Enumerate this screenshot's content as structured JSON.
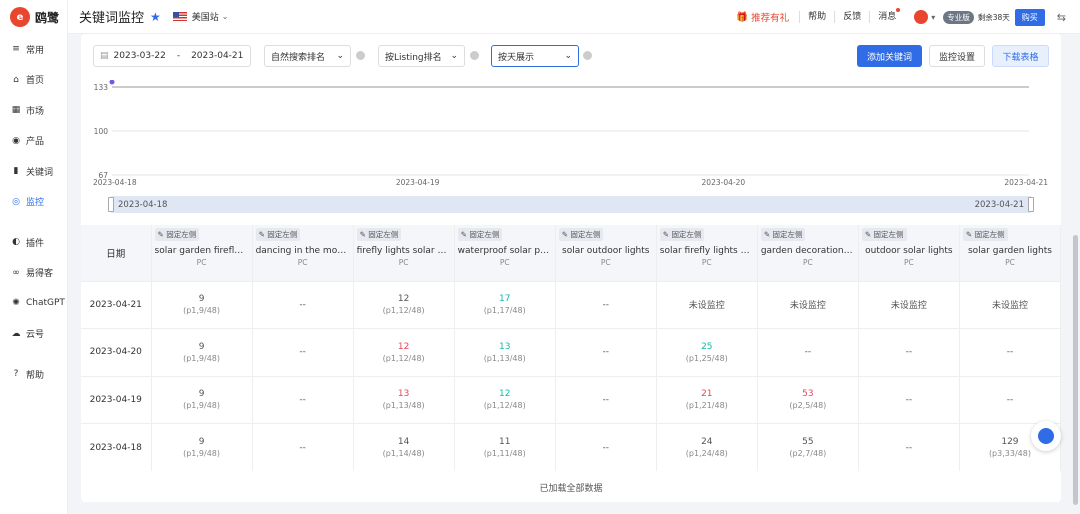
{
  "app": {
    "logo_letter": "e",
    "logo_text": "鸥鹭"
  },
  "sidebar": {
    "items": [
      {
        "label": "常用",
        "icon": "≡"
      },
      {
        "label": "首页",
        "icon": "⌂"
      },
      {
        "label": "市场",
        "icon": "▦"
      },
      {
        "label": "产品",
        "icon": "◉"
      },
      {
        "label": "关键词",
        "icon": "▮"
      },
      {
        "label": "监控",
        "icon": "◎"
      },
      {
        "label": "插件",
        "icon": "◐"
      },
      {
        "label": "易得客",
        "icon": "∞"
      },
      {
        "label": "ChatGPT",
        "icon": "✺"
      },
      {
        "label": "云号",
        "icon": "☁"
      },
      {
        "label": "帮助",
        "icon": "?"
      }
    ]
  },
  "topbar": {
    "title": "关键词监控",
    "site": "美国站",
    "promo": "推荐有礼",
    "help": "帮助",
    "feedback": "反馈",
    "message": "消息",
    "plan": "专业版",
    "remaining": "剩余38天",
    "buy": "购买"
  },
  "filters": {
    "start_date": "2023-03-22",
    "end_date": "2023-04-21",
    "sep": "-",
    "search_rank": "自然搜索排名",
    "listing_rank": "按Listing排名",
    "display_mode": "按天展示",
    "add_keyword": "添加关键词",
    "monitor_settings": "监控设置",
    "download": "下载表格"
  },
  "chart_data": {
    "type": "line",
    "x": [
      "2023-04-18",
      "2023-04-19",
      "2023-04-20",
      "2023-04-21"
    ],
    "y_ticks": [
      "67",
      "100",
      "133"
    ],
    "ylim": [
      133,
      67
    ],
    "series": [
      {
        "values": [
          133,
          null,
          null,
          null
        ]
      }
    ],
    "slider": {
      "start": "2023-04-18",
      "end": "2023-04-21"
    }
  },
  "table": {
    "date_header": "日期",
    "pin_label": "固定左侧",
    "columns": [
      {
        "keyword": "solar garden firefly li...",
        "device": "PC"
      },
      {
        "keyword": "dancing in the moon ...",
        "device": "PC"
      },
      {
        "keyword": "firefly lights solar out...",
        "device": "PC"
      },
      {
        "keyword": "waterproof solar pow...",
        "device": "PC"
      },
      {
        "keyword": "solar outdoor lights",
        "device": "PC"
      },
      {
        "keyword": "solar firefly lights out...",
        "device": "PC"
      },
      {
        "keyword": "garden decorations o...",
        "device": "PC"
      },
      {
        "keyword": "outdoor solar lights",
        "device": "PC"
      },
      {
        "keyword": "solar garden lights",
        "device": "PC"
      }
    ],
    "rows": [
      {
        "date": "2023-04-21",
        "cells": [
          {
            "v": "9",
            "s": "(p1,9/48)"
          },
          {
            "v": "--"
          },
          {
            "v": "12",
            "s": "(p1,12/48)"
          },
          {
            "v": "17",
            "s": "(p1,17/48)",
            "c": "green"
          },
          {
            "v": "--"
          },
          {
            "v": "未设监控"
          },
          {
            "v": "未设监控"
          },
          {
            "v": "未设监控"
          },
          {
            "v": "未设监控"
          }
        ]
      },
      {
        "date": "2023-04-20",
        "cells": [
          {
            "v": "9",
            "s": "(p1,9/48)"
          },
          {
            "v": "--"
          },
          {
            "v": "12",
            "s": "(p1,12/48)",
            "c": "red"
          },
          {
            "v": "13",
            "s": "(p1,13/48)",
            "c": "green"
          },
          {
            "v": "--"
          },
          {
            "v": "25",
            "s": "(p1,25/48)",
            "c": "green"
          },
          {
            "v": "--"
          },
          {
            "v": "--"
          },
          {
            "v": "--"
          }
        ]
      },
      {
        "date": "2023-04-19",
        "cells": [
          {
            "v": "9",
            "s": "(p1,9/48)"
          },
          {
            "v": "--"
          },
          {
            "v": "13",
            "s": "(p1,13/48)",
            "c": "red"
          },
          {
            "v": "12",
            "s": "(p1,12/48)",
            "c": "green"
          },
          {
            "v": "--"
          },
          {
            "v": "21",
            "s": "(p1,21/48)",
            "c": "red"
          },
          {
            "v": "53",
            "s": "(p2,5/48)",
            "c": "red"
          },
          {
            "v": "--"
          },
          {
            "v": "--"
          }
        ]
      },
      {
        "date": "2023-04-18",
        "cells": [
          {
            "v": "9",
            "s": "(p1,9/48)"
          },
          {
            "v": "--"
          },
          {
            "v": "14",
            "s": "(p1,14/48)"
          },
          {
            "v": "11",
            "s": "(p1,11/48)"
          },
          {
            "v": "--"
          },
          {
            "v": "24",
            "s": "(p1,24/48)"
          },
          {
            "v": "55",
            "s": "(p2,7/48)"
          },
          {
            "v": "--"
          },
          {
            "v": "129",
            "s": "(p3,33/48)"
          }
        ]
      }
    ]
  },
  "footer": {
    "loaded": "已加载全部数据"
  }
}
